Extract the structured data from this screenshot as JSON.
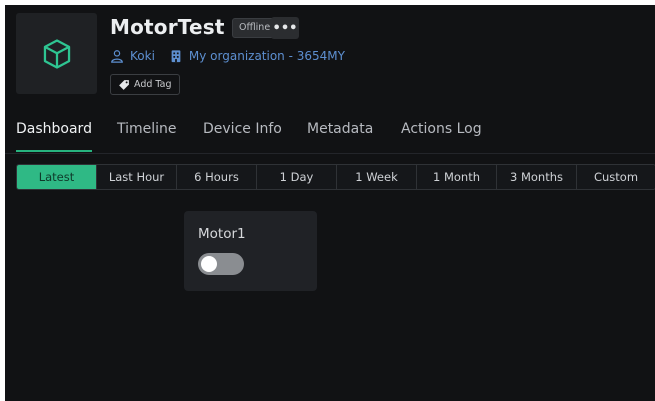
{
  "device": {
    "name": "MotorTest",
    "status": "Offline",
    "more_label": "•••",
    "owner": "Koki",
    "organization": "My organization - 3654MY",
    "add_tag_label": "Add Tag",
    "icon": "cube-icon"
  },
  "tabs": [
    {
      "label": "Dashboard",
      "active": true
    },
    {
      "label": "Timeline",
      "active": false
    },
    {
      "label": "Device Info",
      "active": false
    },
    {
      "label": "Metadata",
      "active": false
    },
    {
      "label": "Actions Log",
      "active": false
    }
  ],
  "time_ranges": [
    {
      "label": "Latest",
      "active": true
    },
    {
      "label": "Last Hour",
      "active": false
    },
    {
      "label": "6 Hours",
      "active": false
    },
    {
      "label": "1 Day",
      "active": false
    },
    {
      "label": "1 Week",
      "active": false
    },
    {
      "label": "1 Month",
      "active": false
    },
    {
      "label": "3 Months",
      "active": false
    },
    {
      "label": "Custom",
      "active": false
    }
  ],
  "widgets": [
    {
      "title": "Motor1",
      "type": "switch",
      "state": "off"
    }
  ],
  "colors": {
    "accent": "#2fb985",
    "link": "#5d8fd0",
    "background": "#111214",
    "card": "#202226"
  }
}
